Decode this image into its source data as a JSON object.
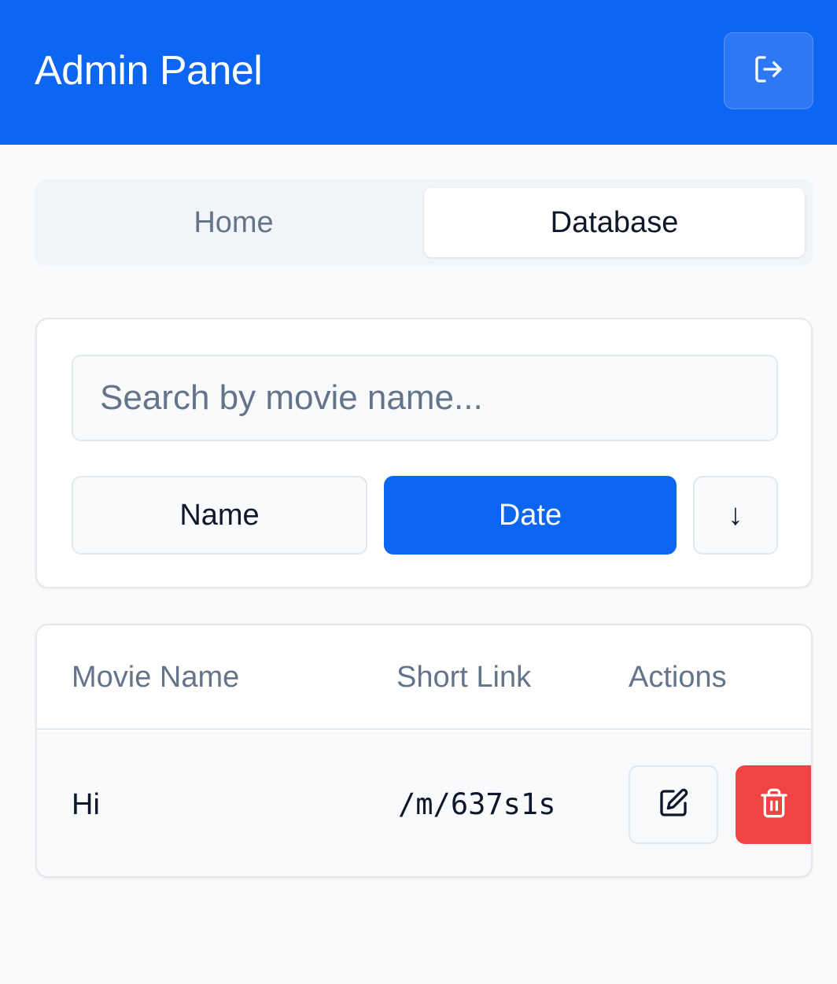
{
  "header": {
    "title": "Admin Panel",
    "logout_icon": "log-out-icon"
  },
  "tabs": [
    {
      "label": "Home",
      "active": false
    },
    {
      "label": "Database",
      "active": true
    }
  ],
  "filters": {
    "search_placeholder": "Search by movie name...",
    "search_value": "",
    "sort_options": [
      {
        "label": "Name",
        "active": false
      },
      {
        "label": "Date",
        "active": true
      }
    ],
    "sort_direction_glyph": "↓",
    "sort_direction_icon": "arrow-down-icon"
  },
  "table": {
    "columns": [
      "Movie Name",
      "Short Link",
      "Actions"
    ],
    "rows": [
      {
        "movie_name": "Hi",
        "short_link": "/m/637s1s"
      }
    ],
    "edit_icon": "edit-icon",
    "delete_icon": "trash-icon"
  },
  "colors": {
    "accent": "#0d66f2",
    "danger": "#ef4444",
    "background": "#f9fafb",
    "muted_text": "#64748b"
  }
}
